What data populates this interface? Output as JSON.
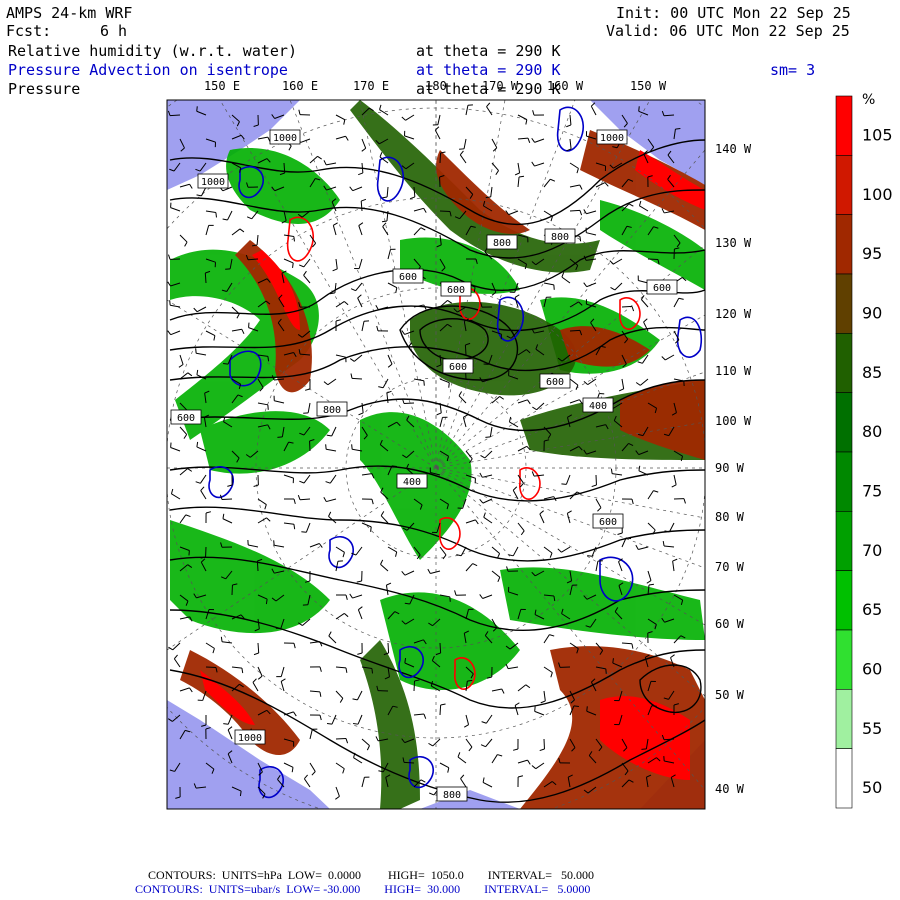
{
  "header": {
    "model": "AMPS 24-km WRF",
    "fcst_label": "Fcst:",
    "fcst_value": "6 h",
    "init": "Init: 00 UTC Mon 22 Sep 25",
    "valid": "Valid: 06 UTC Mon 22 Sep 25",
    "fields": [
      {
        "name": "Relative humidity (w.r.t. water)",
        "level": "at theta = 290 K",
        "color": "#000000"
      },
      {
        "name": "Pressure Advection on isentrope",
        "level": "at theta = 290 K",
        "color": "#0000c8",
        "smooth": "sm= 3"
      },
      {
        "name": "Pressure",
        "level": "at theta = 290 K",
        "color": "#000000"
      }
    ]
  },
  "map": {
    "lon_labels_top": [
      "150 E",
      "160 E",
      "170 E",
      "180",
      "170 W",
      "160 W",
      "150 W"
    ],
    "lon_labels_right": [
      "140 W",
      "130 W",
      "120 W",
      "110 W",
      "100 W",
      "90 W",
      "80 W",
      "70 W",
      "60 W",
      "50 W",
      "40 W"
    ],
    "contour_labels": [
      "1000",
      "1000",
      "1000",
      "800",
      "800",
      "600",
      "600",
      "600",
      "600",
      "600",
      "600",
      "800",
      "400",
      "400",
      "600",
      "1000",
      "800"
    ],
    "colors": {
      "ocean_ice": "#a0a0f0",
      "land_mask": "#d8d8ff"
    }
  },
  "colorbar": {
    "unit": "%",
    "tick_labels": [
      "105",
      "100",
      "95",
      "90",
      "85",
      "80",
      "75",
      "70",
      "65",
      "60",
      "55",
      "50"
    ],
    "bins": [
      {
        "min": 105,
        "color": "#ff0000"
      },
      {
        "min": 100,
        "color": "#d01800"
      },
      {
        "min": 95,
        "color": "#a02800"
      },
      {
        "min": 90,
        "color": "#604000"
      },
      {
        "min": 85,
        "color": "#206000"
      },
      {
        "min": 80,
        "color": "#007000"
      },
      {
        "min": 75,
        "color": "#008800"
      },
      {
        "min": 70,
        "color": "#00a000"
      },
      {
        "min": 65,
        "color": "#00c000"
      },
      {
        "min": 60,
        "color": "#30e030"
      },
      {
        "min": 55,
        "color": "#a0f0a0"
      },
      {
        "min": 50,
        "color": "#ffffff"
      }
    ]
  },
  "footer": {
    "line1": "CONTOURS:  UNITS=hPa  LOW=  0.0000         HIGH=  1050.0        INTERVAL=   50.000",
    "line2": "CONTOURS:  UNITS=ubar/s  LOW= -30.000        HIGH=  30.000        INTERVAL=   5.0000"
  }
}
